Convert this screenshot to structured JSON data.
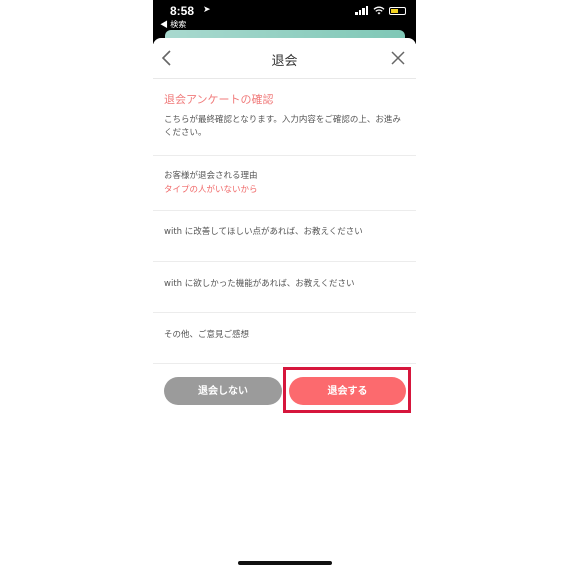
{
  "status_bar": {
    "time": "8:58",
    "back_app": "◀ 検索"
  },
  "nav": {
    "title": "退会"
  },
  "confirm": {
    "title": "退会アンケートの確認",
    "description": "こちらが最終確認となります。入力内容をご確認の上、お進みください。"
  },
  "questions": [
    {
      "label": "お客様が退会される理由",
      "answer": "タイプの人がいないから"
    },
    {
      "label": "with に改善してほしい点があれば、お教えください",
      "answer": ""
    },
    {
      "label": "with に欲しかった機能があれば、お教えください",
      "answer": ""
    },
    {
      "label": "その他、ご意見ご感想",
      "answer": ""
    }
  ],
  "buttons": {
    "stay_label": "退会しない",
    "leave_label": "退会する"
  },
  "colors": {
    "accent": "#fc6a6e",
    "answer_text": "#f06a6a",
    "stay_button": "#9b9b9b",
    "highlight_border": "#d6163c"
  }
}
